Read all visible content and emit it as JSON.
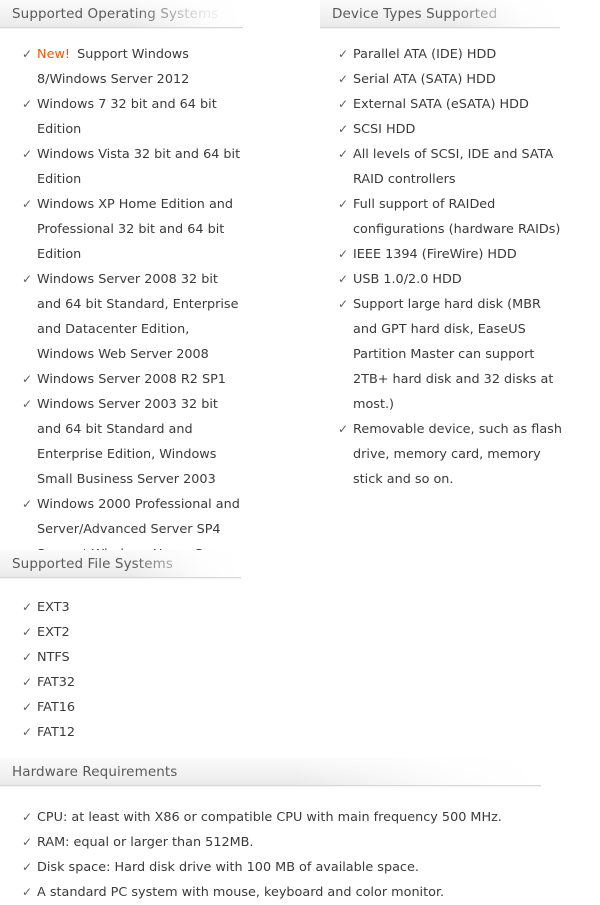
{
  "sections": {
    "operating_systems": {
      "title": "Supported Operating Systems",
      "items": [
        {
          "badge": "New!",
          "text": "Support Windows 8/Windows Server 2012"
        },
        {
          "badge": "",
          "text": "Windows 7 32 bit and 64 bit Edition"
        },
        {
          "badge": "",
          "text": "Windows Vista 32 bit and 64 bit Edition"
        },
        {
          "badge": "",
          "text": "Windows XP Home Edition and Professional 32 bit and 64 bit Edition"
        },
        {
          "badge": "",
          "text": "Windows Server 2008 32 bit and 64 bit Standard, Enterprise and Datacenter Edition, Windows Web Server 2008"
        },
        {
          "badge": "",
          "text": "Windows Server 2008 R2 SP1"
        },
        {
          "badge": "",
          "text": "Windows Server 2003 32 bit and 64 bit Standard and Enterprise Edition, Windows Small Business Server 2003"
        },
        {
          "badge": "",
          "text": "Windows 2000 Professional and Server/Advanced Server SP4"
        },
        {
          "badge": "",
          "text": "Support Windows Home Server"
        }
      ]
    },
    "device_types": {
      "title": "Device Types Supported",
      "items": [
        {
          "badge": "",
          "text": "Parallel ATA (IDE) HDD"
        },
        {
          "badge": "",
          "text": "Serial ATA (SATA) HDD"
        },
        {
          "badge": "",
          "text": "External SATA (eSATA) HDD"
        },
        {
          "badge": "",
          "text": "SCSI HDD"
        },
        {
          "badge": "",
          "text": "All levels of SCSI, IDE and SATA RAID controllers"
        },
        {
          "badge": "",
          "text": "Full support of RAIDed configurations (hardware RAIDs)"
        },
        {
          "badge": "",
          "text": "IEEE 1394 (FireWire) HDD"
        },
        {
          "badge": "",
          "text": "USB 1.0/2.0 HDD"
        },
        {
          "badge": "",
          "text": "Support large hard disk (MBR and GPT hard disk, EaseUS Partition Master can support 2TB+ hard disk and 32 disks at most.)"
        },
        {
          "badge": "",
          "text": "Removable device, such as flash drive, memory card, memory stick and so on."
        }
      ]
    },
    "file_systems": {
      "title": "Supported File Systems",
      "items": [
        {
          "badge": "",
          "text": "EXT3"
        },
        {
          "badge": "",
          "text": "EXT2"
        },
        {
          "badge": "",
          "text": "NTFS"
        },
        {
          "badge": "",
          "text": "FAT32"
        },
        {
          "badge": "",
          "text": "FAT16"
        },
        {
          "badge": "",
          "text": "FAT12"
        }
      ]
    },
    "hardware_requirements": {
      "title": "Hardware Requirements",
      "items": [
        {
          "badge": "",
          "text": "CPU: at least with X86 or compatible CPU with main frequency 500 MHz."
        },
        {
          "badge": "",
          "text": "RAM: equal or larger than 512MB."
        },
        {
          "badge": "",
          "text": "Disk space: Hard disk drive with 100 MB of available space."
        },
        {
          "badge": "",
          "text": "A standard PC system with mouse, keyboard and color monitor."
        }
      ]
    }
  },
  "icons": {
    "check": "✓"
  },
  "colors": {
    "header_text": "#5a5a5a",
    "body_text": "#3a3a3a",
    "check_mark": "#5e5e5e",
    "new_badge": "#e8590c",
    "header_bar_top": "#fbfbfb",
    "header_bar_bottom": "#e9e9e9",
    "header_bar_border": "#d8d8d8",
    "background": "#ffffff"
  }
}
